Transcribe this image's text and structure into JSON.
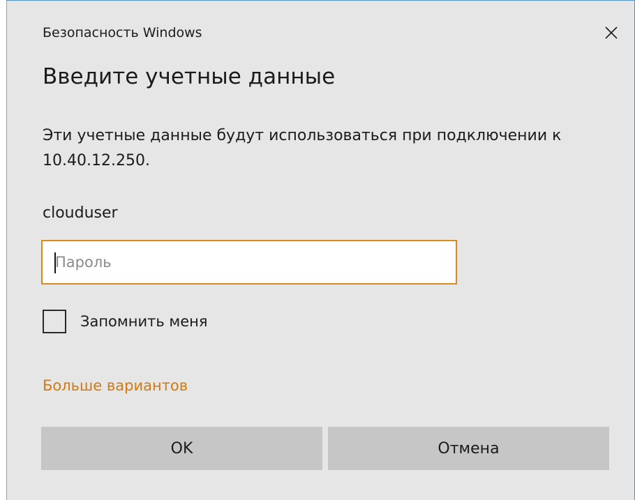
{
  "window": {
    "title": "Безопасность Windows",
    "close_icon": "close-icon"
  },
  "heading": "Введите учетные данные",
  "description": "Эти учетные данные будут использоваться при подключении к 10.40.12.250.",
  "username": "clouduser",
  "password": {
    "value": "",
    "placeholder": "Пароль"
  },
  "remember": {
    "label": "Запомнить меня",
    "checked": false
  },
  "more_options_link": "Больше вариантов",
  "buttons": {
    "ok_label": "OK",
    "cancel_label": "Отмена"
  },
  "colors": {
    "accent": "#d88a1f",
    "link": "#d4790e",
    "background": "#e6e6e6",
    "button": "#c6c6c6"
  }
}
